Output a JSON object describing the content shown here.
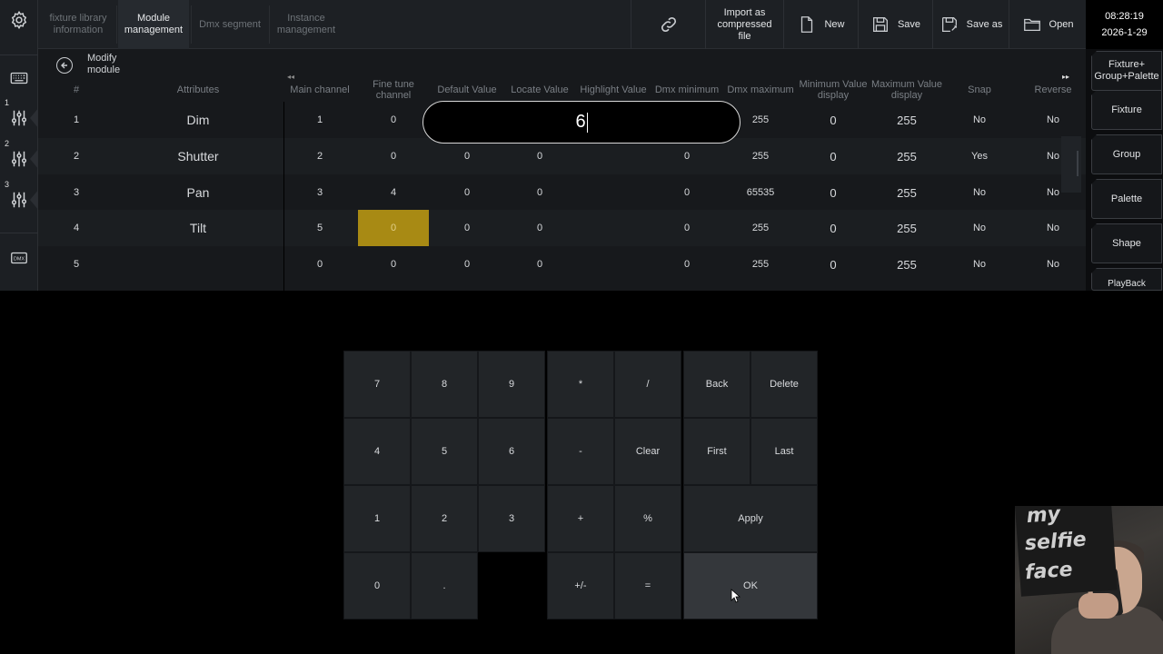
{
  "top_tabs": [
    {
      "label": "fixture library information",
      "active": false
    },
    {
      "label": "Module management",
      "active": true
    },
    {
      "label": "Dmx segment",
      "active": false
    },
    {
      "label": "Instance management",
      "active": false
    }
  ],
  "toolbar": {
    "import_label": "Import as compressed file",
    "new_label": "New",
    "save_label": "Save",
    "save_as_label": "Save as",
    "open_label": "Open"
  },
  "clock": {
    "time": "08:28:19",
    "date": "2026-1-29"
  },
  "left_sidebar": {
    "fader_numbers": [
      "1",
      "2",
      "3"
    ],
    "dmx_label": "DMX"
  },
  "right_panel": {
    "items": [
      "Fixture+ Group+Palette",
      "Fixture",
      "Group",
      "Palette",
      "Shape",
      "PlayBack"
    ]
  },
  "breadcrumb": {
    "label": "Modify module"
  },
  "table": {
    "columns": [
      "#",
      "Attributes",
      "Main channel",
      "Fine tune channel",
      "Default Value",
      "Locate Value",
      "Highlight Value",
      "Dmx minimum",
      "Dmx maximum",
      "Minimum Value display",
      "Maximum Value display",
      "Snap",
      "Reverse"
    ],
    "rows": [
      [
        "1",
        "Dim",
        "1",
        "0",
        "",
        "",
        "",
        "",
        "255",
        "0",
        "255",
        "No",
        "No"
      ],
      [
        "2",
        "Shutter",
        "2",
        "0",
        "0",
        "0",
        "",
        "0",
        "255",
        "0",
        "255",
        "Yes",
        "No"
      ],
      [
        "3",
        "Pan",
        "3",
        "4",
        "0",
        "0",
        "",
        "0",
        "65535",
        "0",
        "255",
        "No",
        "No"
      ],
      [
        "4",
        "Tilt",
        "5",
        "0",
        "0",
        "0",
        "",
        "0",
        "255",
        "0",
        "255",
        "No",
        "No"
      ],
      [
        "5",
        "",
        "0",
        "0",
        "0",
        "0",
        "",
        "0",
        "255",
        "0",
        "255",
        "No",
        "No"
      ]
    ]
  },
  "edit_input": {
    "value": "6"
  },
  "keypad": {
    "keys": [
      "7",
      "8",
      "9",
      "*",
      "/",
      "Back",
      "Delete",
      "4",
      "5",
      "6",
      "-",
      "Clear",
      "First",
      "Last",
      "1",
      "2",
      "3",
      "+",
      "%",
      "Apply",
      "0",
      ".",
      "+/-",
      "=",
      "OK"
    ]
  },
  "webcam": {
    "sticker_lines": [
      "my",
      "selfie",
      "face"
    ]
  },
  "colors": {
    "highlight_cell": "#a88a14",
    "background": "#17191c",
    "topbar": "#1d2024"
  }
}
